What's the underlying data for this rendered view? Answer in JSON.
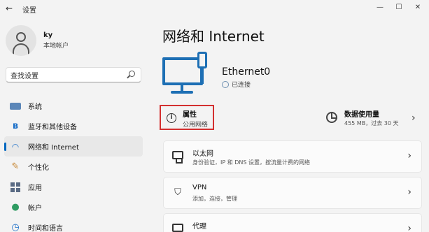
{
  "window": {
    "back_glyph": "←",
    "title": "设置",
    "minimize_glyph": "—",
    "maximize_glyph": "☐",
    "close_glyph": "✕"
  },
  "user": {
    "name": "ky",
    "account_type": "本地帐户"
  },
  "search": {
    "value": "查找设置"
  },
  "nav": {
    "items": [
      {
        "label": "系统",
        "icon": "system-icon"
      },
      {
        "label": "蓝牙和其他设备",
        "icon": "bluetooth-icon"
      },
      {
        "label": "网络和 Internet",
        "icon": "wifi-icon",
        "active": true
      },
      {
        "label": "个性化",
        "icon": "brush-icon"
      },
      {
        "label": "应用",
        "icon": "apps-icon"
      },
      {
        "label": "帐户",
        "icon": "account-icon"
      },
      {
        "label": "时间和语言",
        "icon": "time-icon"
      }
    ]
  },
  "main": {
    "title": "网络和 Internet",
    "ethernet": {
      "name": "Ethernet0",
      "status": "已连接"
    },
    "properties": {
      "title": "属性",
      "subtitle": "公用网络"
    },
    "data_usage": {
      "title": "数据使用量",
      "subtitle": "455 MB，过去 30 天"
    },
    "cards": [
      {
        "title": "以太网",
        "subtitle": "身份验证，IP 和 DNS 设置，按流量计费的网络",
        "icon": "ethernet-icon"
      },
      {
        "title": "VPN",
        "subtitle": "添加，连接，管理",
        "icon": "shield-icon"
      },
      {
        "title": "代理",
        "subtitle": "",
        "icon": "proxy-icon"
      }
    ],
    "chevron_glyph": "›"
  },
  "colors": {
    "accent": "#0067c0",
    "highlight_border": "#d32f2f",
    "network_icon": "#1d6fb4"
  }
}
